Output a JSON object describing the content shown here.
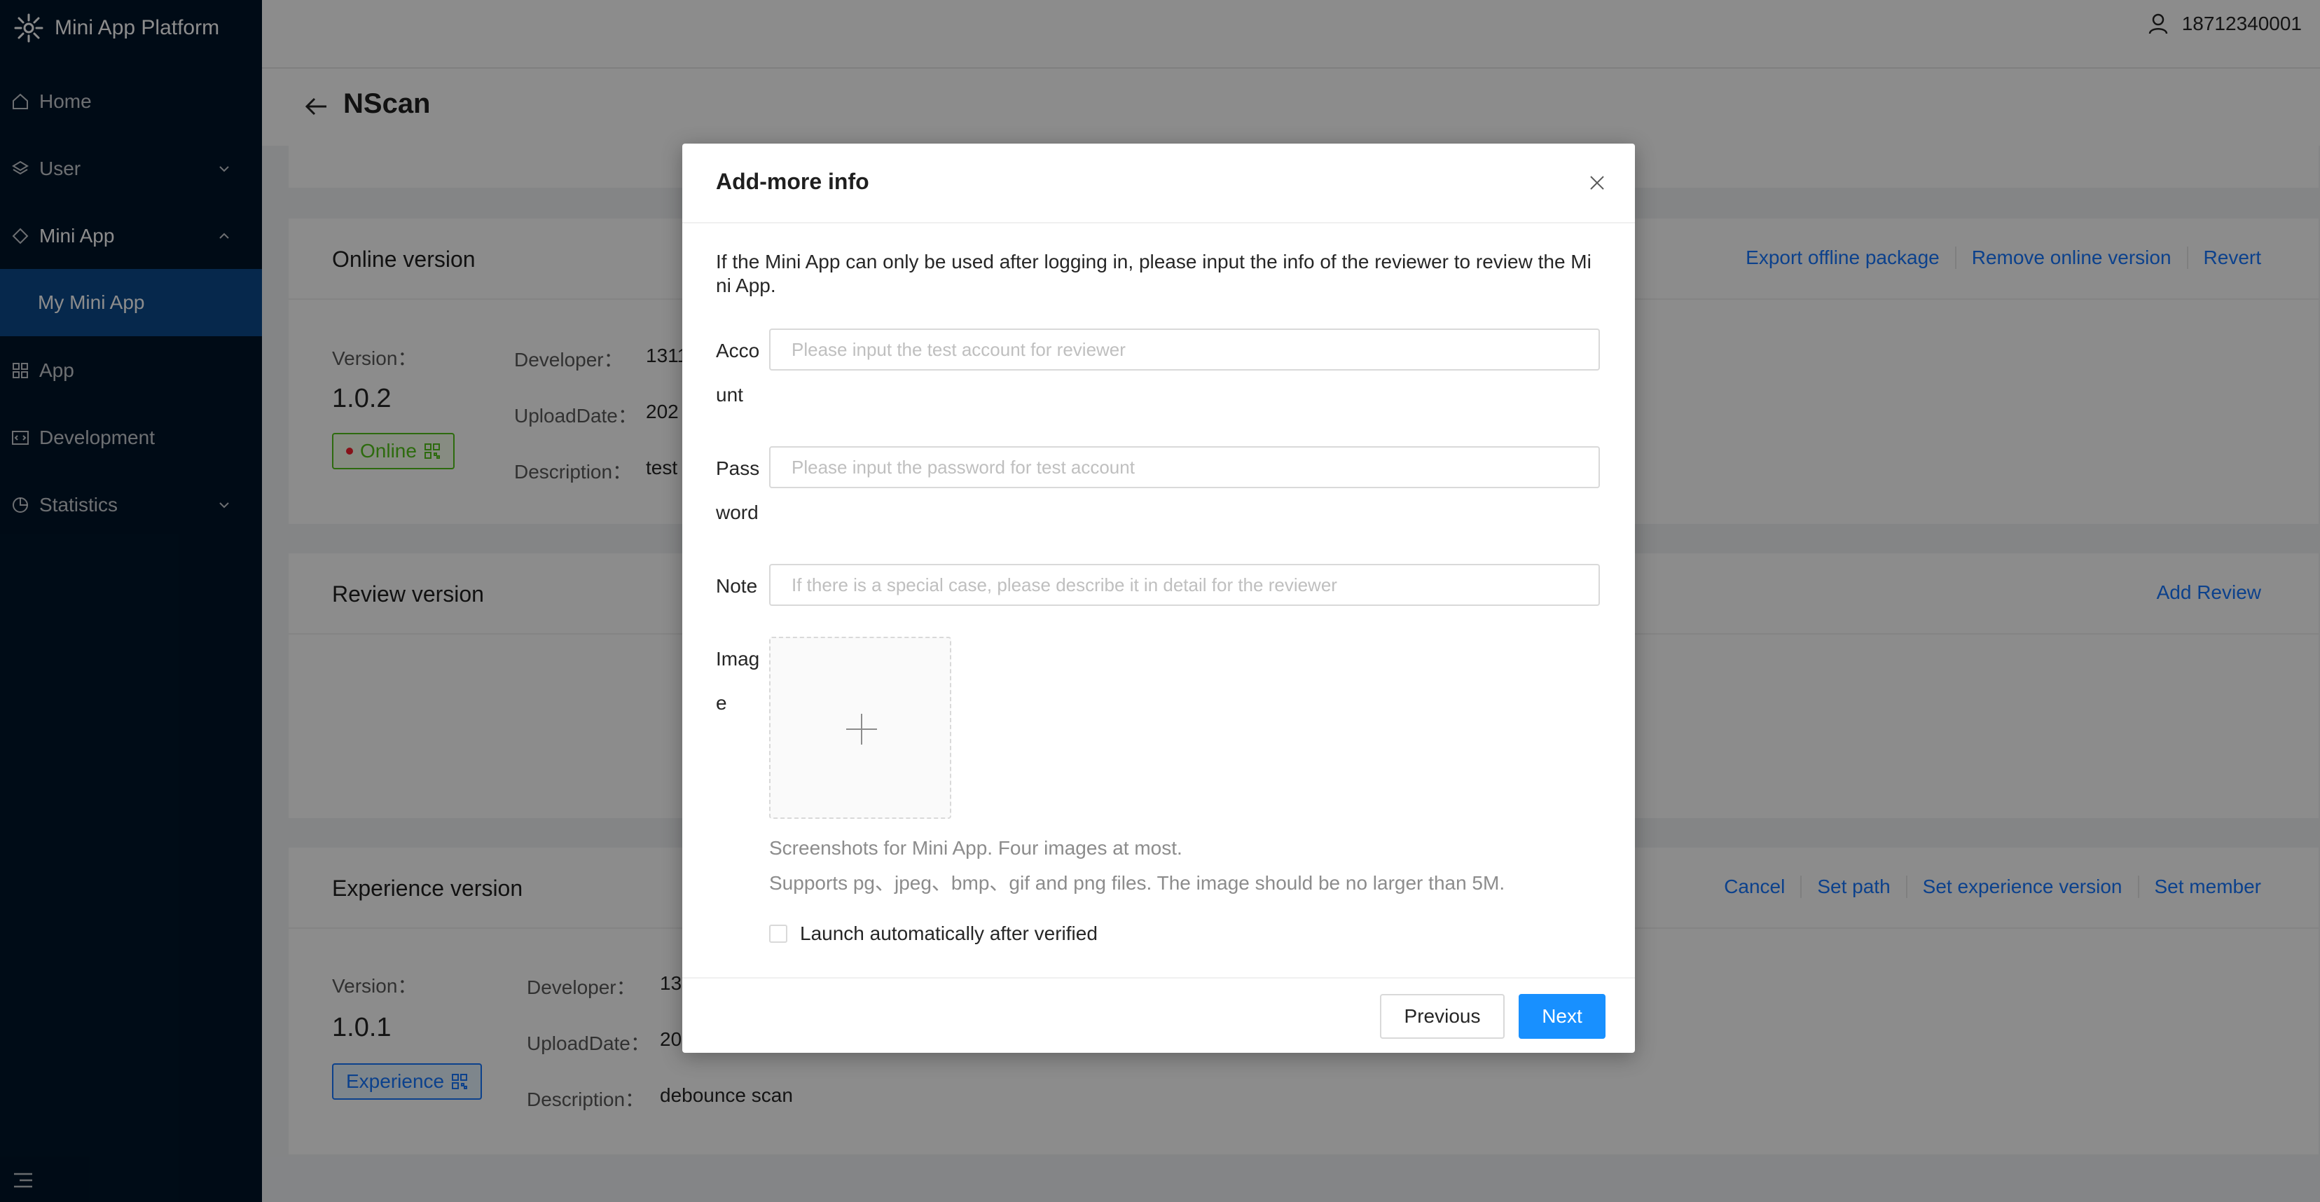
{
  "app": {
    "name": "Mini App Platform"
  },
  "sidebar": {
    "items": [
      {
        "label": "Home"
      },
      {
        "label": "User"
      },
      {
        "label": "Mini App"
      },
      {
        "label": "My Mini App"
      },
      {
        "label": "App"
      },
      {
        "label": "Development"
      },
      {
        "label": "Statistics"
      }
    ]
  },
  "header": {
    "user": "18712340001"
  },
  "page": {
    "title": "NScan"
  },
  "online": {
    "title": "Online version",
    "actions": [
      "Export offline package",
      "Remove online version",
      "Revert"
    ],
    "version_label": "Version：",
    "version": "1.0.2",
    "status": "Online",
    "developer_label": "Developer：",
    "developer": "1311",
    "upload_label": "UploadDate：",
    "upload": "202",
    "desc_label": "Description：",
    "desc": "test"
  },
  "review": {
    "title": "Review version",
    "action": "Add Review"
  },
  "experience": {
    "title": "Experience version",
    "actions": [
      "Cancel",
      "Set path",
      "Set experience version",
      "Set member"
    ],
    "version_label": "Version：",
    "version": "1.0.1",
    "status": "Experience",
    "developer_label": "Developer：",
    "developer": "131",
    "upload_label": "UploadDate：",
    "upload": "20",
    "desc_label": "Description：",
    "desc": "debounce scan"
  },
  "modal": {
    "title": "Add-more info",
    "intro": "If the Mini App can only be used after logging in, please input the info of the reviewer to review the Mini App.",
    "account_label": "Account",
    "account_placeholder": "Please input the test account for reviewer",
    "password_label": "Password",
    "password_placeholder": "Please input the password for test account",
    "note_label": "Note",
    "note_placeholder": "If there is a special case, please describe it in detail for the reviewer",
    "image_label": "Image",
    "hint1": "Screenshots for Mini App. Four images at most.",
    "hint2": "Supports pg、jpeg、bmp、gif and png files. The image should be no larger than 5M.",
    "checkbox_label": "Launch automatically after verified",
    "prev": "Previous",
    "next": "Next"
  }
}
